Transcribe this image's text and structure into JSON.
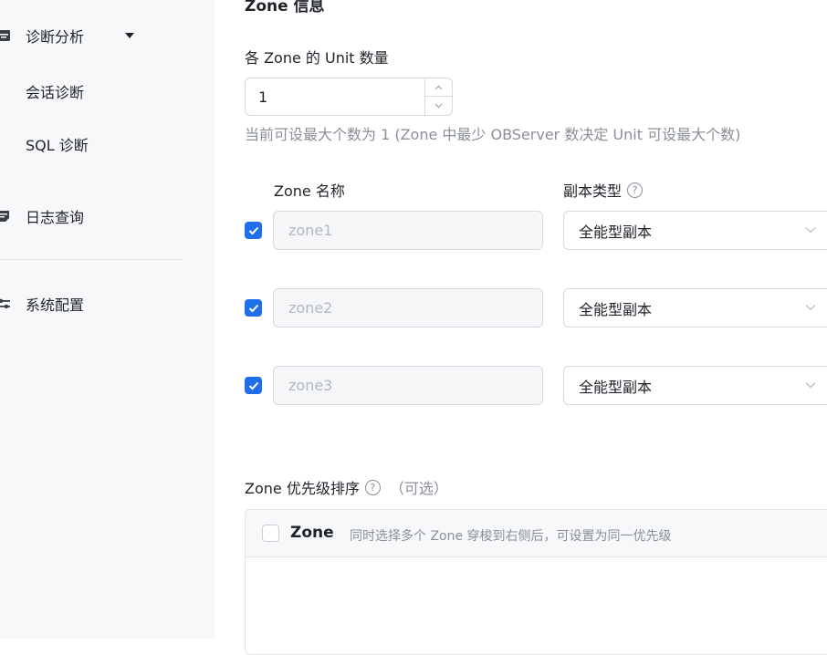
{
  "sidebar": {
    "diagnosis": {
      "label": "诊断分析",
      "icon": "panel-icon"
    },
    "sub_items": [
      {
        "label": "会话诊断"
      },
      {
        "label": "SQL 诊断"
      }
    ],
    "log_query": {
      "label": "日志查询",
      "icon": "log-icon"
    },
    "system_config": {
      "label": "系统配置",
      "icon": "sliders-icon"
    }
  },
  "main": {
    "section_title": "Zone 信息",
    "unit_count": {
      "label": "各 Zone 的 Unit 数量",
      "value": "1",
      "hint": "当前可设最大个数为 1 (Zone 中最少 OBServer 数决定 Unit 可设最大个数)"
    },
    "columns": {
      "zone_name": "Zone 名称",
      "replica_type": "副本类型"
    },
    "zones": [
      {
        "name": "zone1",
        "replica_type": "全能型副本",
        "checked": true
      },
      {
        "name": "zone2",
        "replica_type": "全能型副本",
        "checked": true
      },
      {
        "name": "zone3",
        "replica_type": "全能型副本",
        "checked": true
      }
    ],
    "priority": {
      "title": "Zone 优先级排序",
      "optional": "（可选）",
      "transfer_title": "Zone",
      "transfer_hint": "同时选择多个 Zone 穿梭到右侧后，可设置为同一优先级"
    }
  },
  "colors": {
    "accent": "#1f6feb",
    "sidebar_bg": "#f7f8fa",
    "hint_text": "#8a8f99"
  }
}
